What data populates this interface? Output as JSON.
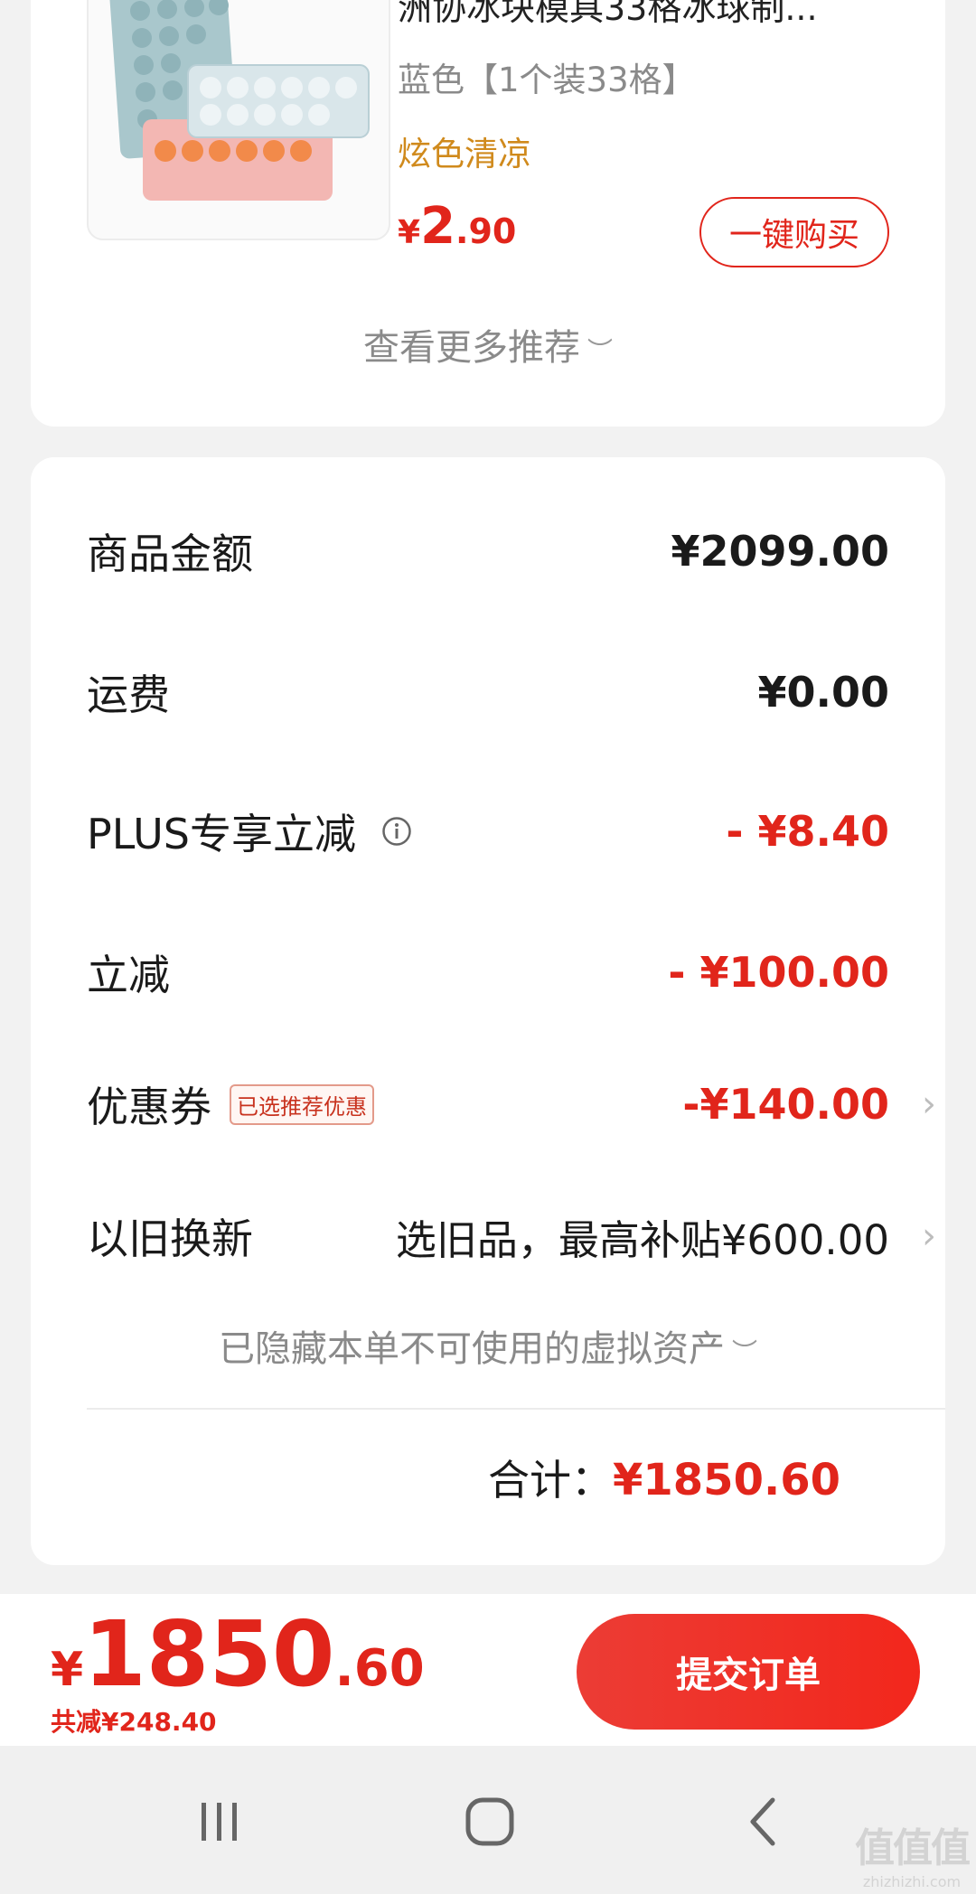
{
  "recommendation": {
    "product": {
      "title": "洲协冰块模具33格冰球制...",
      "variant": "蓝色【1个装33格】",
      "tag": "炫色清凉",
      "price_currency": "¥",
      "price_int": "2",
      "price_dec": ".90",
      "buy_label": "一键购买"
    },
    "more_label": "查看更多推荐"
  },
  "summary": {
    "rows": [
      {
        "label": "商品金额",
        "value": "¥2099.00"
      },
      {
        "label": "运费",
        "value": "¥0.00"
      },
      {
        "label": "PLUS专享立减",
        "value": "- ¥8.40"
      },
      {
        "label": "立减",
        "value": "- ¥100.00"
      },
      {
        "label": "优惠券",
        "badge": "已选推荐优惠",
        "value": "-¥140.00"
      },
      {
        "label": "以旧换新",
        "value": "选旧品，最高补贴¥600.00"
      }
    ],
    "hidden_assets_label": "已隐藏本单不可使用的虚拟资产",
    "total_label": "合计：",
    "total_value": "¥1850.60"
  },
  "bottom_bar": {
    "price_currency": "¥",
    "price_int": "1850",
    "price_dec": ".60",
    "saved_label": "共减¥248.40",
    "submit_label": "提交订单"
  },
  "watermark": {
    "text": "值值值",
    "site": "zhizhizhi.com"
  },
  "colors": {
    "accent": "#e1251b",
    "tag": "#d08a1c",
    "muted": "#8a8a8a"
  },
  "icons": [
    "info-icon",
    "chevron-down-icon",
    "chevron-right-icon",
    "recent-apps-icon",
    "home-icon",
    "back-icon"
  ]
}
